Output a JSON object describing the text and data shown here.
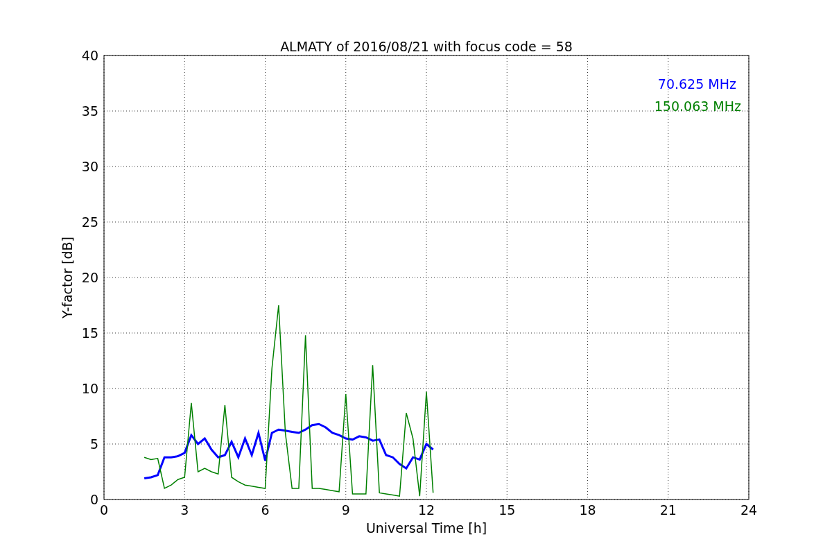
{
  "chart_data": {
    "type": "line",
    "title": "ALMATY of 2016/08/21 with focus code = 58",
    "xlabel": "Universal Time [h]",
    "ylabel": "Y-factor [dB]",
    "x": [
      1.5,
      1.75,
      2.0,
      2.25,
      2.5,
      2.75,
      3.0,
      3.25,
      3.5,
      3.75,
      4.0,
      4.25,
      4.5,
      4.75,
      5.0,
      5.25,
      5.5,
      5.75,
      6.0,
      6.25,
      6.5,
      6.75,
      7.0,
      7.25,
      7.5,
      7.75,
      8.0,
      8.25,
      8.5,
      8.75,
      9.0,
      9.25,
      9.5,
      9.75,
      10.0,
      10.25,
      10.5,
      10.75,
      11.0,
      11.25,
      11.5,
      11.75,
      12.0,
      12.25
    ],
    "series": [
      {
        "name": "70.625 MHz",
        "color": "#0000ff",
        "values": [
          1.9,
          2.0,
          2.2,
          3.8,
          3.8,
          3.9,
          4.2,
          5.8,
          5.0,
          5.5,
          4.5,
          3.8,
          4.0,
          5.2,
          3.8,
          5.5,
          4.0,
          6.0,
          3.5,
          6.0,
          6.3,
          6.2,
          6.1,
          6.0,
          6.3,
          6.7,
          6.8,
          6.5,
          6.0,
          5.8,
          5.5,
          5.4,
          5.7,
          5.6,
          5.3,
          5.4,
          4.0,
          3.8,
          3.2,
          2.8,
          3.8,
          3.6,
          5.0,
          4.5
        ]
      },
      {
        "name": "150.063 MHz",
        "color": "#008000",
        "values": [
          3.8,
          3.6,
          3.7,
          1.0,
          1.3,
          1.8,
          2.0,
          8.7,
          2.5,
          2.8,
          2.5,
          2.3,
          8.5,
          2.0,
          1.6,
          1.3,
          1.2,
          1.1,
          1.0,
          11.8,
          17.5,
          6.0,
          1.0,
          1.0,
          14.8,
          1.0,
          1.0,
          0.9,
          0.8,
          0.7,
          9.5,
          0.5,
          0.5,
          0.5,
          12.1,
          0.6,
          0.5,
          0.4,
          0.3,
          7.8,
          5.5,
          0.3,
          9.7,
          0.6
        ]
      }
    ],
    "xlim": [
      0,
      24
    ],
    "ylim": [
      0,
      40
    ],
    "xticks": [
      0,
      3,
      6,
      9,
      12,
      15,
      18,
      21,
      24
    ],
    "yticks": [
      0,
      5,
      10,
      15,
      20,
      25,
      30,
      35,
      40
    ],
    "grid": true
  }
}
